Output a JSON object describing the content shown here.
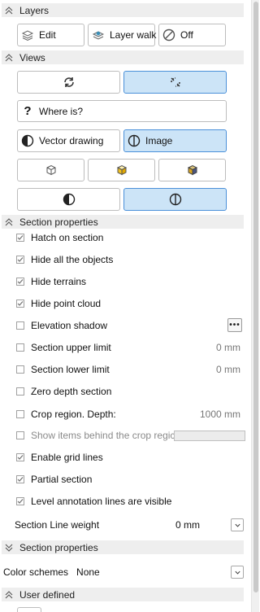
{
  "sections": {
    "layers": "Layers",
    "views": "Views",
    "section_properties": "Section properties",
    "section_properties_2": "Section properties",
    "user_defined": "User defined"
  },
  "layers": {
    "edit": "Edit",
    "layer_walk": "Layer walk",
    "off": "Off"
  },
  "views": {
    "where_is": "Where is?",
    "vector_drawing": "Vector drawing",
    "image": "Image"
  },
  "options": [
    {
      "label": "Hatch on section",
      "checked": true
    },
    {
      "label": "Hide all the objects",
      "checked": true
    },
    {
      "label": "Hide terrains",
      "checked": true
    },
    {
      "label": "Hide point cloud",
      "checked": true
    },
    {
      "label": "Elevation shadow",
      "checked": false
    },
    {
      "label": "Section upper limit",
      "checked": false,
      "value": "0 mm"
    },
    {
      "label": "Section lower limit",
      "checked": false,
      "value": "0 mm"
    },
    {
      "label": "Zero depth section",
      "checked": false
    },
    {
      "label": "Crop region. Depth:",
      "checked": false,
      "value": "1000 mm"
    },
    {
      "label": "Show items behind the crop regic",
      "checked": false,
      "disabled": true
    },
    {
      "label": "Enable grid lines",
      "checked": true
    },
    {
      "label": "Partial section",
      "checked": true
    },
    {
      "label": "Level annotation lines are visible",
      "checked": true
    }
  ],
  "section_line_weight": {
    "label": "Section Line weight",
    "value": "0 mm"
  },
  "color_schemes": {
    "label": "Color schemes",
    "value": "None"
  },
  "colors": {
    "accent_bg": "#cce4f7",
    "accent_border": "#4a90d9",
    "header_bg": "#eeeeee"
  }
}
